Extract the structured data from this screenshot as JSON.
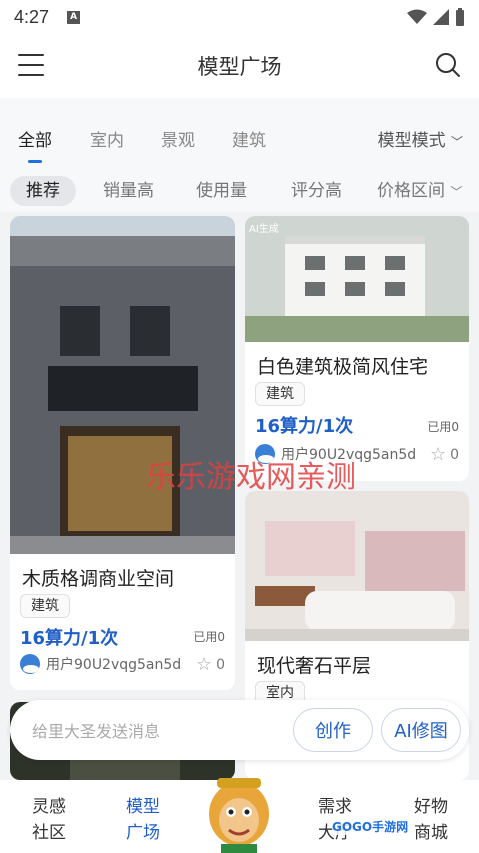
{
  "status": {
    "time": "4:27",
    "notif_icon": "A"
  },
  "topbar": {
    "title": "模型广场"
  },
  "tabs": [
    {
      "label": "全部"
    },
    {
      "label": "室内"
    },
    {
      "label": "景观"
    },
    {
      "label": "建筑"
    }
  ],
  "mode_label": "模型模式",
  "filters": [
    {
      "label": "推荐"
    },
    {
      "label": "销量高"
    },
    {
      "label": "使用量"
    },
    {
      "label": "评分高"
    },
    {
      "label": "价格区间"
    }
  ],
  "cards": [
    {
      "title": "木质格调商业空间",
      "tag": "建筑",
      "price": "16算力/1次",
      "used": "已用0",
      "user": "用户90U2vqg5an5d",
      "stars": "0"
    },
    {
      "title": "白色建筑极简风住宅",
      "tag": "建筑",
      "price": "16算力/1次",
      "used": "已用0",
      "user": "用户90U2vqg5an5d",
      "stars": "0",
      "image_label": "AI生成"
    },
    {
      "title": "现代奢石平层",
      "tag": "室内"
    }
  ],
  "watermark": "乐乐游戏网亲测",
  "input": {
    "placeholder": "给里大圣发送消息",
    "create_button": "创作",
    "ai_button": "AI修图"
  },
  "nav": [
    {
      "line1": "灵感",
      "line2": "社区"
    },
    {
      "line1": "模型",
      "line2": "广场"
    },
    {
      "line1": "需求",
      "line2": "大厅"
    },
    {
      "line1": "好物",
      "line2": "商城"
    }
  ],
  "gogo_logo": "GOGO手游网"
}
